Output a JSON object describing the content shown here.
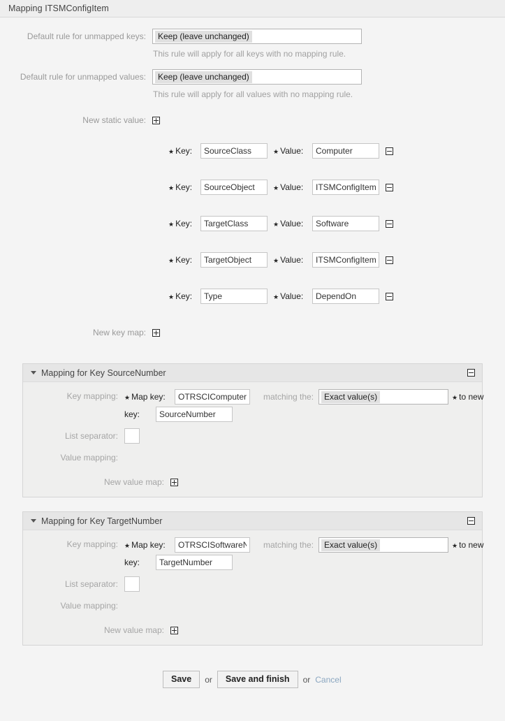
{
  "window": {
    "title": "Mapping ITSMConfigItem"
  },
  "defaults": {
    "keys_label": "Default rule for unmapped keys:",
    "keys_value": "Keep (leave unchanged)",
    "keys_hint": "This rule will apply for all keys with no mapping rule.",
    "values_label": "Default rule for unmapped values:",
    "values_value": "Keep (leave unchanged)",
    "values_hint": "This rule will apply for all values with no mapping rule."
  },
  "static_values": {
    "add_label": "New static value:",
    "key_label": "Key:",
    "value_label": "Value:",
    "rows": [
      {
        "key": "SourceClass",
        "value": "Computer"
      },
      {
        "key": "SourceObject",
        "value": "ITSMConfigItem"
      },
      {
        "key": "TargetClass",
        "value": "Software"
      },
      {
        "key": "TargetObject",
        "value": "ITSMConfigItem"
      },
      {
        "key": "Type",
        "value": "DependOn"
      }
    ]
  },
  "new_key_map": {
    "label": "New key map:"
  },
  "panels": [
    {
      "title": "Mapping for Key SourceNumber",
      "key_mapping_label": "Key mapping:",
      "map_key_label": "Map key:",
      "map_key_value": "OTRSCIComputerN",
      "matching_label": "matching the:",
      "matching_value": "Exact value(s)",
      "to_new_label": "to new",
      "new_key_label": "key:",
      "new_key_value": "SourceNumber",
      "list_separator_label": "List separator:",
      "list_separator_value": "",
      "value_mapping_label": "Value mapping:",
      "new_value_map_label": "New value map:"
    },
    {
      "title": "Mapping for Key TargetNumber",
      "key_mapping_label": "Key mapping:",
      "map_key_label": "Map key:",
      "map_key_value": "OTRSCISoftwareNu",
      "matching_label": "matching the:",
      "matching_value": "Exact value(s)",
      "to_new_label": "to new",
      "new_key_label": "key:",
      "new_key_value": "TargetNumber",
      "list_separator_label": "List separator:",
      "list_separator_value": "",
      "value_mapping_label": "Value mapping:",
      "new_value_map_label": "New value map:"
    }
  ],
  "footer": {
    "save_label": "Save",
    "or_1": "or",
    "save_finish_label": "Save and finish",
    "or_2": "or",
    "cancel_label": "Cancel"
  },
  "icons": {
    "add": "plus-square-icon",
    "remove": "minus-square-icon",
    "collapse": "minus-square-icon",
    "expanded": "caret-down-icon"
  },
  "colors": {
    "page_bg": "#f4f4f4",
    "header_bg": "#eeeeee",
    "panel_head_bg": "#e6e6e6",
    "panel_body_bg": "#efefee",
    "link": "#8aa6c0"
  }
}
